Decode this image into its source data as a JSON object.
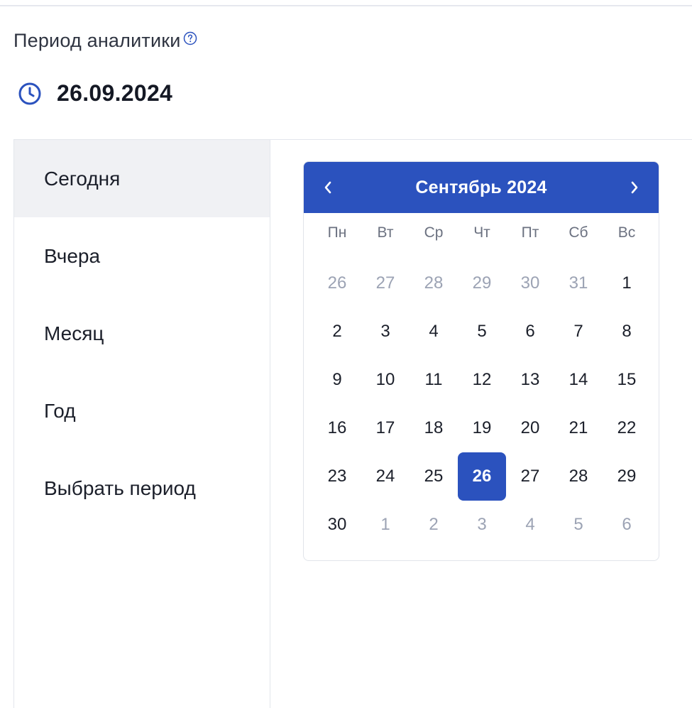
{
  "label": "Период аналитики",
  "date_value": "26.09.2024",
  "presets": [
    "Сегодня",
    "Вчера",
    "Месяц",
    "Год",
    "Выбрать период"
  ],
  "active_preset_index": 0,
  "calendar": {
    "title": "Сентябрь 2024",
    "weekdays": [
      "Пн",
      "Вт",
      "Ср",
      "Чт",
      "Пт",
      "Сб",
      "Вс"
    ],
    "weeks": [
      [
        {
          "d": "26",
          "m": true
        },
        {
          "d": "27",
          "m": true
        },
        {
          "d": "28",
          "m": true
        },
        {
          "d": "29",
          "m": true
        },
        {
          "d": "30",
          "m": true
        },
        {
          "d": "31",
          "m": true
        },
        {
          "d": "1"
        }
      ],
      [
        {
          "d": "2"
        },
        {
          "d": "3"
        },
        {
          "d": "4"
        },
        {
          "d": "5"
        },
        {
          "d": "6"
        },
        {
          "d": "7"
        },
        {
          "d": "8"
        }
      ],
      [
        {
          "d": "9"
        },
        {
          "d": "10"
        },
        {
          "d": "11"
        },
        {
          "d": "12"
        },
        {
          "d": "13"
        },
        {
          "d": "14"
        },
        {
          "d": "15"
        }
      ],
      [
        {
          "d": "16"
        },
        {
          "d": "17"
        },
        {
          "d": "18"
        },
        {
          "d": "19"
        },
        {
          "d": "20"
        },
        {
          "d": "21"
        },
        {
          "d": "22"
        }
      ],
      [
        {
          "d": "23"
        },
        {
          "d": "24"
        },
        {
          "d": "25"
        },
        {
          "d": "26",
          "s": true
        },
        {
          "d": "27"
        },
        {
          "d": "28"
        },
        {
          "d": "29"
        }
      ],
      [
        {
          "d": "30"
        },
        {
          "d": "1",
          "m": true
        },
        {
          "d": "2",
          "m": true
        },
        {
          "d": "3",
          "m": true
        },
        {
          "d": "4",
          "m": true
        },
        {
          "d": "5",
          "m": true
        },
        {
          "d": "6",
          "m": true
        }
      ]
    ]
  },
  "colors": {
    "accent": "#2b52be",
    "muted_day": "#9ca3b4",
    "active_preset_bg": "#f0f1f4"
  },
  "icons": {
    "help": "question-circle-icon",
    "clock": "clock-icon",
    "prev": "chevron-left-icon",
    "next": "chevron-right-icon"
  }
}
